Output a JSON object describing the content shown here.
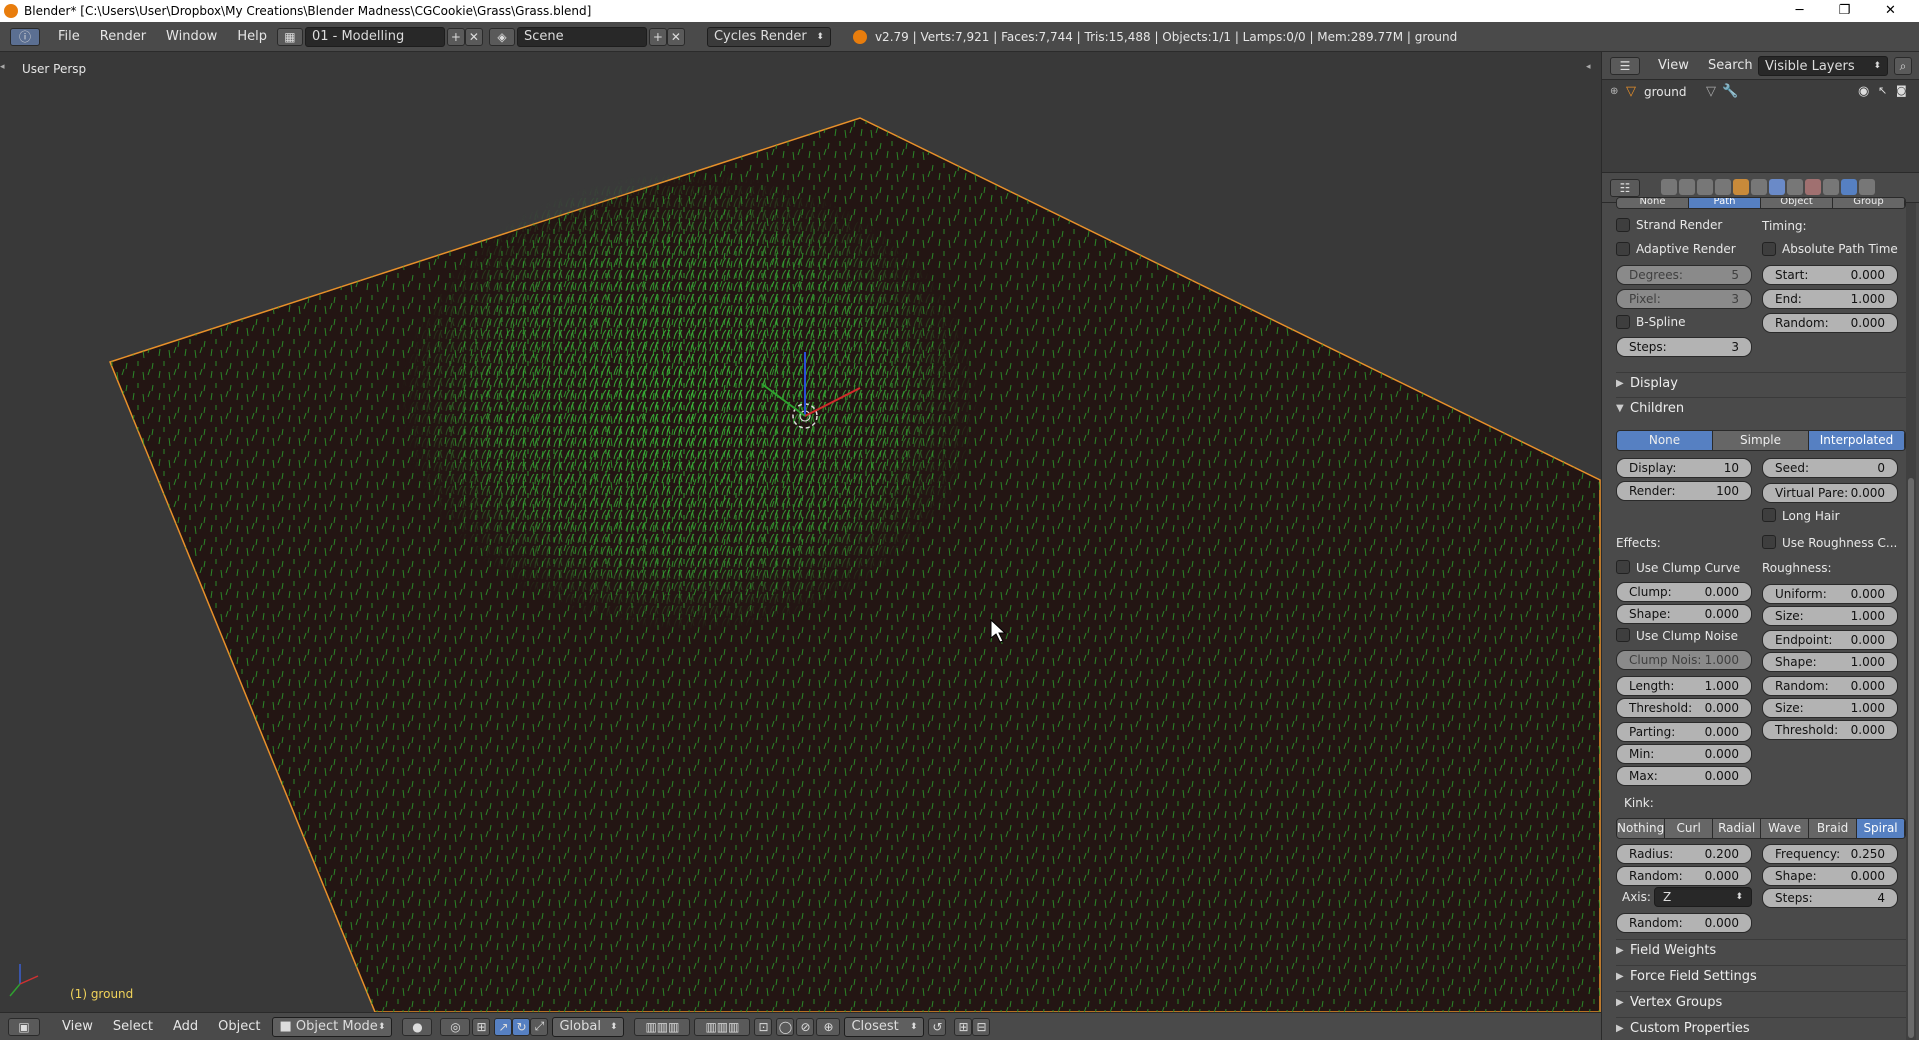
{
  "window": {
    "title": "Blender* [C:\\Users\\User\\Dropbox\\My Creations\\Blender Madness\\CGCookie\\Grass\\Grass.blend]",
    "minimize": "─",
    "maximize": "❐",
    "close": "✕"
  },
  "infobar": {
    "menus": [
      "File",
      "Render",
      "Window",
      "Help"
    ],
    "screen_layout": "01 - Modelling",
    "scene": "Scene",
    "render_engine": "Cycles Render",
    "stats": "v2.79 | Verts:7,921 | Faces:7,744 | Tris:15,488 | Objects:1/1 | Lamps:0/0 | Mem:289.77M | ground"
  },
  "viewport": {
    "view_name": "User Persp",
    "object_label": "(1) ground"
  },
  "viewport_header": {
    "menus": [
      "View",
      "Select",
      "Add",
      "Object"
    ],
    "mode": "Object Mode",
    "orientation": "Global",
    "snap": "Closest"
  },
  "outliner": {
    "menus": [
      "View",
      "Search"
    ],
    "filter": "Visible Layers",
    "item": "ground"
  },
  "properties": {
    "top_tabs": [
      "None",
      "Path",
      "Object",
      "Group"
    ],
    "strand_render": "Strand Render",
    "adaptive_render": "Adaptive Render",
    "degrees": {
      "label": "Degrees:",
      "value": "5"
    },
    "pixel": {
      "label": "Pixel:",
      "value": "3"
    },
    "bspline": "B-Spline",
    "steps": {
      "label": "Steps:",
      "value": "3"
    },
    "timing": "Timing:",
    "absolute_path_time": "Absolute Path Time",
    "start": {
      "label": "Start:",
      "value": "0.000"
    },
    "end": {
      "label": "End:",
      "value": "1.000"
    },
    "random_t": {
      "label": "Random:",
      "value": "0.000"
    },
    "display_panel": "Display",
    "children_panel": "Children",
    "children_tabs": [
      "None",
      "Simple",
      "Interpolated"
    ],
    "children_active": 2,
    "display": {
      "label": "Display:",
      "value": "10"
    },
    "render": {
      "label": "Render:",
      "value": "100"
    },
    "seed": {
      "label": "Seed:",
      "value": "0"
    },
    "virtual_parents": {
      "label": "Virtual Pare:",
      "value": "0.000"
    },
    "long_hair": "Long Hair",
    "effects": "Effects:",
    "use_roughness_curve": "Use Roughness C...",
    "use_clump_curve": "Use Clump Curve",
    "roughness": "Roughness:",
    "clump": {
      "label": "Clump:",
      "value": "0.000"
    },
    "shape": {
      "label": "Shape:",
      "value": "0.000"
    },
    "use_clump_noise": "Use Clump Noise",
    "clump_noise": {
      "label": "Clump Nois:",
      "value": "1.000"
    },
    "length": {
      "label": "Length:",
      "value": "1.000"
    },
    "threshold": {
      "label": "Threshold:",
      "value": "0.000"
    },
    "parting": {
      "label": "Parting:",
      "value": "0.000"
    },
    "min": {
      "label": "Min:",
      "value": "0.000"
    },
    "max": {
      "label": "Max:",
      "value": "0.000"
    },
    "uniform": {
      "label": "Uniform:",
      "value": "0.000"
    },
    "r_size": {
      "label": "Size:",
      "value": "1.000"
    },
    "endpoint": {
      "label": "Endpoint:",
      "value": "0.000"
    },
    "r_shape": {
      "label": "Shape:",
      "value": "1.000"
    },
    "r_random": {
      "label": "Random:",
      "value": "0.000"
    },
    "r_size2": {
      "label": "Size:",
      "value": "1.000"
    },
    "r_threshold": {
      "label": "Threshold:",
      "value": "0.000"
    },
    "kink": "Kink:",
    "kink_tabs": [
      "Nothing",
      "Curl",
      "Radial",
      "Wave",
      "Braid",
      "Spiral"
    ],
    "kink_active": 5,
    "radius": {
      "label": "Radius:",
      "value": "0.200"
    },
    "k_random": {
      "label": "Random:",
      "value": "0.000"
    },
    "axis": {
      "label": "Axis:",
      "value": "Z"
    },
    "k_random2": {
      "label": "Random:",
      "value": "0.000"
    },
    "frequency": {
      "label": "Frequency:",
      "value": "0.250"
    },
    "k_shape": {
      "label": "Shape:",
      "value": "0.000"
    },
    "k_steps": {
      "label": "Steps:",
      "value": "4"
    },
    "panels": [
      "Field Weights",
      "Force Field Settings",
      "Vertex Groups",
      "Custom Properties"
    ]
  }
}
